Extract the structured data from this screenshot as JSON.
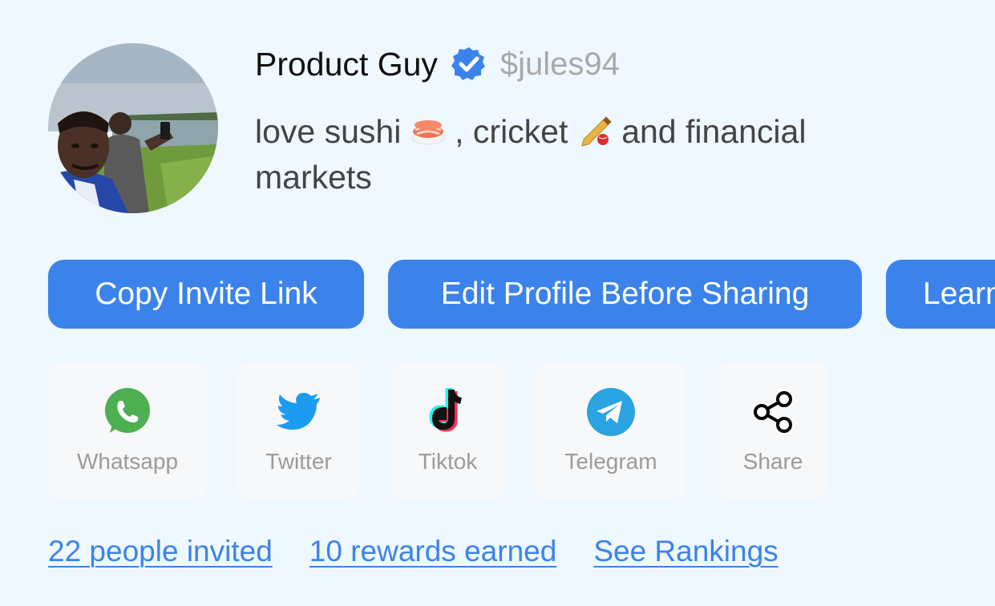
{
  "profile": {
    "display_name": "Product Guy",
    "handle": "$jules94",
    "verified": true,
    "bio_part1": "love sushi",
    "bio_part2": ", cricket",
    "bio_part3": " and financial markets",
    "bio_emojis": [
      "sushi-emoji",
      "cricket-emoji"
    ]
  },
  "actions": {
    "copy_invite": "Copy Invite Link",
    "edit_profile": "Edit Profile Before Sharing",
    "learn": "Learn"
  },
  "share": {
    "items": [
      {
        "label": "Whatsapp",
        "icon": "whatsapp-icon",
        "color": "#4caf50"
      },
      {
        "label": "Twitter",
        "icon": "twitter-icon",
        "color": "#1d9bf0"
      },
      {
        "label": "Tiktok",
        "icon": "tiktok-icon",
        "color": "#000000"
      },
      {
        "label": "Telegram",
        "icon": "telegram-icon",
        "color": "#2aa3e0"
      },
      {
        "label": "Share",
        "icon": "share-icon",
        "color": "#000000"
      }
    ]
  },
  "stats": {
    "invited": "22 people invited",
    "rewards": "10 rewards earned",
    "rankings": "See Rankings"
  },
  "colors": {
    "accent": "#3b83ea",
    "background": "#eef8fe",
    "handle": "#a9a9a9"
  }
}
